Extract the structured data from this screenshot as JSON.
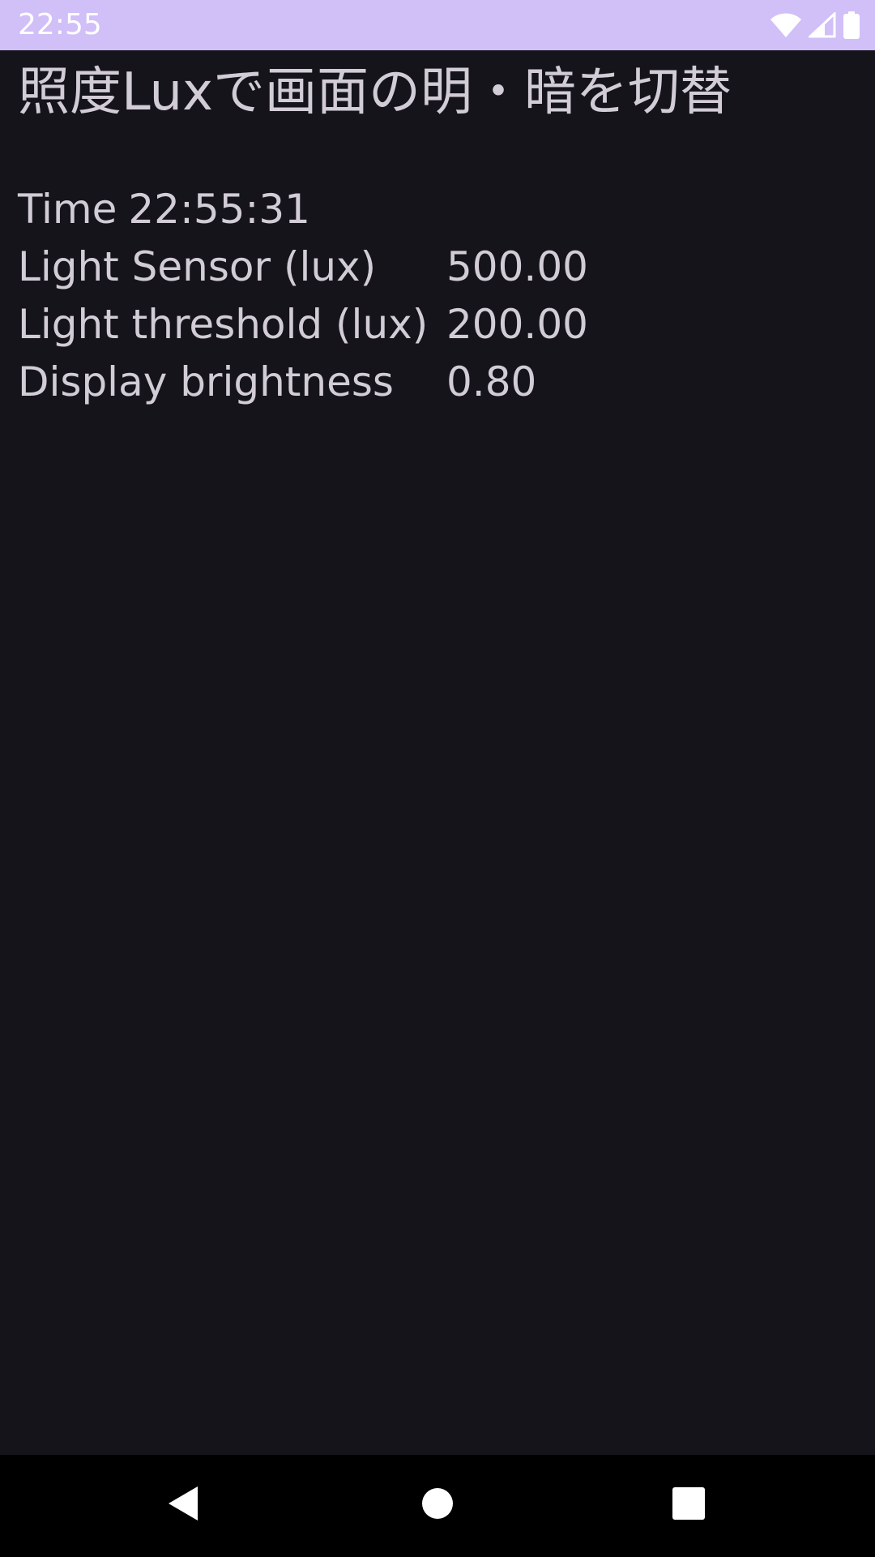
{
  "status_bar": {
    "time": "22:55",
    "icons": [
      "wifi-icon",
      "signal-icon",
      "battery-icon"
    ],
    "background": "#d1bff8"
  },
  "page": {
    "title": "照度Luxで画面の明・暗を切替",
    "time_label": "Time",
    "time_value": "22:55:31",
    "readings": [
      {
        "label": "Light Sensor (lux)",
        "value": "500.00"
      },
      {
        "label": "Light threshold (lux)",
        "value": "200.00"
      },
      {
        "label": "Display brightness",
        "value": "0.80"
      }
    ],
    "background": "#16141b",
    "text_color": "#d1ccd6"
  },
  "nav_bar": {
    "buttons": [
      "back-icon",
      "home-icon",
      "recents-icon"
    ]
  }
}
